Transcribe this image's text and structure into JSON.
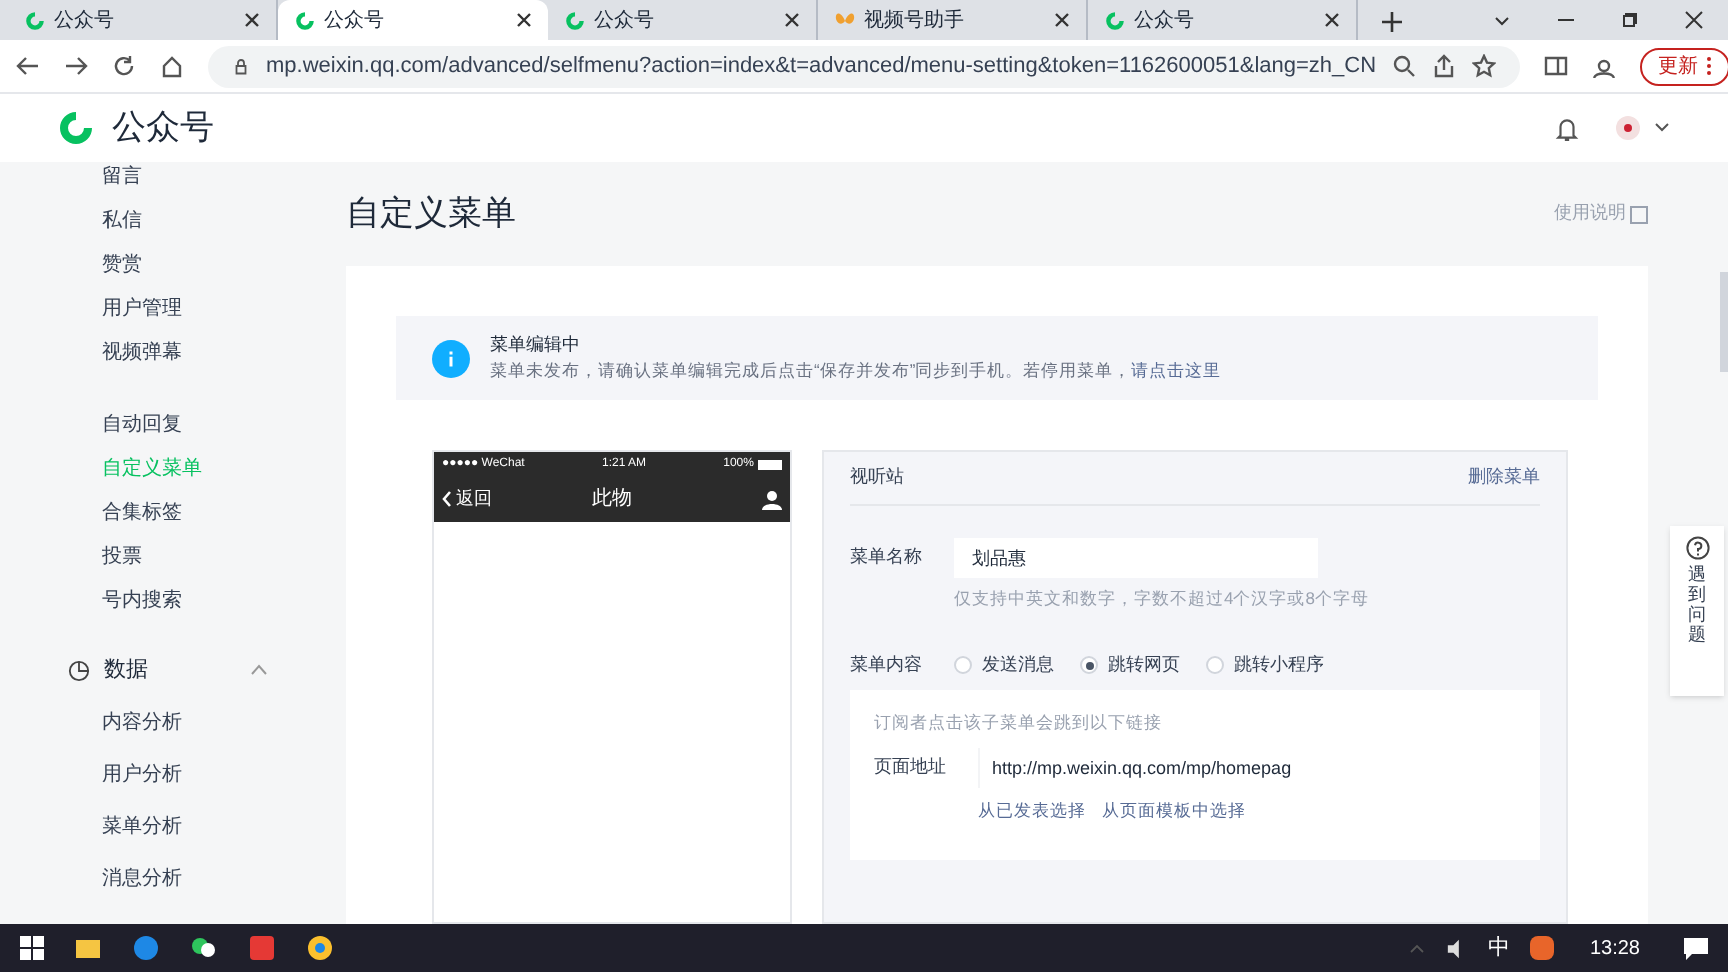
{
  "browser": {
    "tabs": [
      {
        "label": "公众号",
        "selected": false
      },
      {
        "label": "公众号",
        "selected": true
      },
      {
        "label": "公众号",
        "selected": false
      },
      {
        "label": "视频号助手",
        "selected": false
      },
      {
        "label": "公众号",
        "selected": false
      }
    ],
    "url": "mp.weixin.qq.com/advanced/selfmenu?action=index&t=advanced/menu-setting&token=1162600051&lang=zh_CN",
    "update_button": "更新"
  },
  "header": {
    "logo": "公众号"
  },
  "sidebar": {
    "sections": [
      {
        "items": [
          {
            "label": "留言",
            "selected": false
          },
          {
            "label": "私信",
            "selected": false
          },
          {
            "label": "赞赏",
            "selected": false
          },
          {
            "label": "用户管理",
            "selected": false
          },
          {
            "label": "视频弹幕",
            "selected": false
          }
        ]
      },
      {
        "items": [
          {
            "label": "自动回复",
            "selected": false
          },
          {
            "label": "自定义菜单",
            "selected": true
          },
          {
            "label": "合集标签",
            "selected": false
          },
          {
            "label": "投票",
            "selected": false
          },
          {
            "label": "号内搜索",
            "selected": false
          }
        ]
      }
    ],
    "group": {
      "label": "数据",
      "expanded": true,
      "items": [
        {
          "label": "内容分析",
          "selected": false
        },
        {
          "label": "用户分析",
          "selected": false
        },
        {
          "label": "菜单分析",
          "selected": false
        },
        {
          "label": "消息分析",
          "selected": false
        }
      ]
    }
  },
  "page": {
    "title": "自定义菜单",
    "help_link": "使用说明",
    "notice": {
      "title": "菜单编辑中",
      "text": "菜单未发布，请确认菜单编辑完成后点击“保存并发布”同步到手机。若停用菜单，",
      "link": "请点击这里"
    },
    "phone": {
      "carrier": "●●●●● WeChat",
      "time": "1:21 AM",
      "battery": "100%",
      "back": "返回",
      "title": "此物"
    },
    "editor": {
      "title": "视听站",
      "delete_link": "删除菜单",
      "name_label": "菜单名称",
      "name_value": "划品惠",
      "name_hint": "仅支持中英文和数字，字数不超过4个汉字或8个字母",
      "content_label": "菜单内容",
      "options": [
        {
          "label": "发送消息",
          "selected": false
        },
        {
          "label": "跳转网页",
          "selected": true
        },
        {
          "label": "跳转小程序",
          "selected": false
        }
      ],
      "link_hint": "订阅者点击该子菜单会跳到以下链接",
      "url_label": "页面地址",
      "url_value": "http://mp.weixin.qq.com/mp/homepag",
      "choices": [
        "从已发表选择",
        "从页面模板中选择"
      ]
    }
  },
  "help_float": "遇到问题",
  "taskbar": {
    "ime": "中",
    "time": "13:28"
  }
}
